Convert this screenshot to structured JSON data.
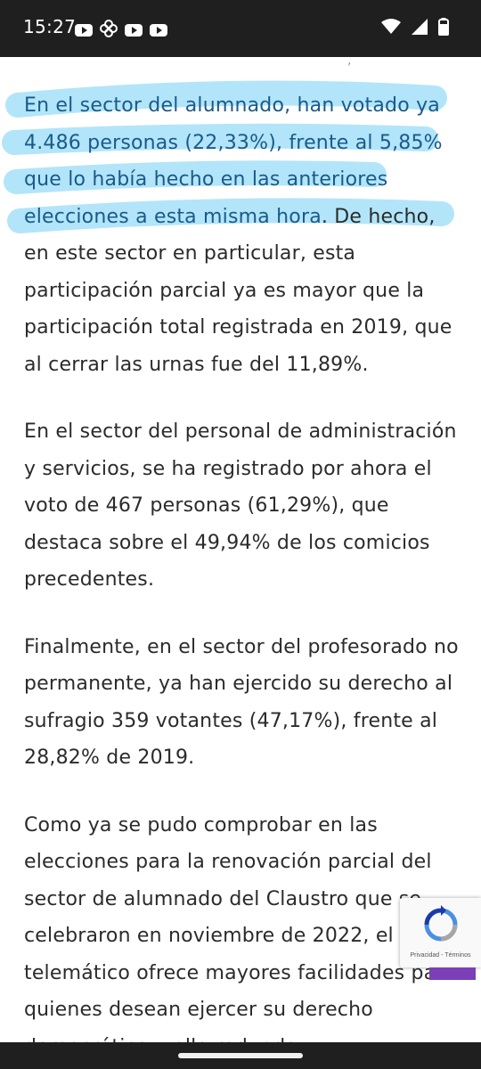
{
  "status_bar": {
    "time": "15:27",
    "left_icons": [
      "youtube-icon",
      "pinwheel-icon",
      "youtube-icon",
      "youtube-icon"
    ],
    "right_icons": [
      "wifi-icon",
      "signal-icon",
      "battery-icon"
    ]
  },
  "article": {
    "top_cut": ",",
    "paragraphs": [
      {
        "highlight": "En el sector del alumnado, han votado ya 4.486 personas (22,33%), frente al 5,85% que lo había hecho en las anteriores elecciones a esta misma hora",
        "rest": ". De hecho, en este sector en particular, esta participación parcial ya es mayor que la participación total registrada en 2019, que al cerrar las urnas fue del 11,89%."
      },
      {
        "text": "En el sector del personal de administración y servicios, se ha registrado por ahora el voto de 467 personas (61,29%), que destaca sobre el 49,94% de los comicios precedentes."
      },
      {
        "text": "Finalmente, en el sector del profesorado no permanente, ya han ejercido su derecho al sufragio 359 votantes (47,17%), frente al 28,82% de 2019."
      },
      {
        "text": "Como ya se pudo comprobar en las elecciones para la renovación parcial del sector de alumnado del Claustro que se celebraron en noviembre de 2022, el voto telemático ofrece mayores facilidades para quienes desean ejercer su derecho democrático y ello redunda"
      }
    ]
  },
  "recaptcha": {
    "legal_text": "Privacidad - Términos"
  },
  "colors": {
    "highlight_marker": "#7fd3f5",
    "highlight_text": "#1a5a8a",
    "body_text": "#2b2b2b",
    "status_bg": "#1f1f1f",
    "accent_purple": "#7b3fb8"
  }
}
